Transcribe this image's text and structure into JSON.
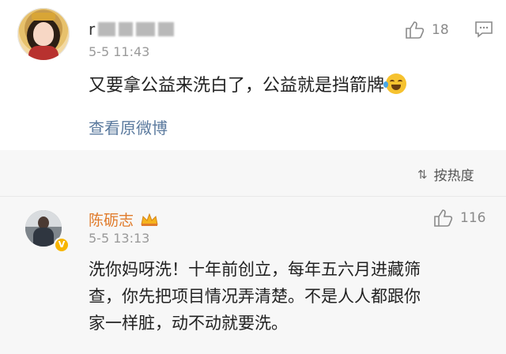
{
  "comment1": {
    "username_visible": "r",
    "timestamp": "5-5 11:43",
    "text": "又要拿公益来洗白了，公益就是挡箭牌",
    "like_count": "18",
    "link": "查看原微博"
  },
  "sort": {
    "label": "按热度"
  },
  "comment2": {
    "username": "陈砺志",
    "timestamp": "5-5 13:13",
    "like_count": "116",
    "text_lines": [
      "洗你妈呀洗！十年前创立，每年五六月进藏筛",
      "查，你先把项目情况弄清楚。不是人人都跟你",
      "家一样脏，动不动就要洗。"
    ]
  },
  "colors": {
    "username_highlight": "#e07b2b",
    "link": "#5b7a9e",
    "verified_badge": "#f7b500"
  }
}
